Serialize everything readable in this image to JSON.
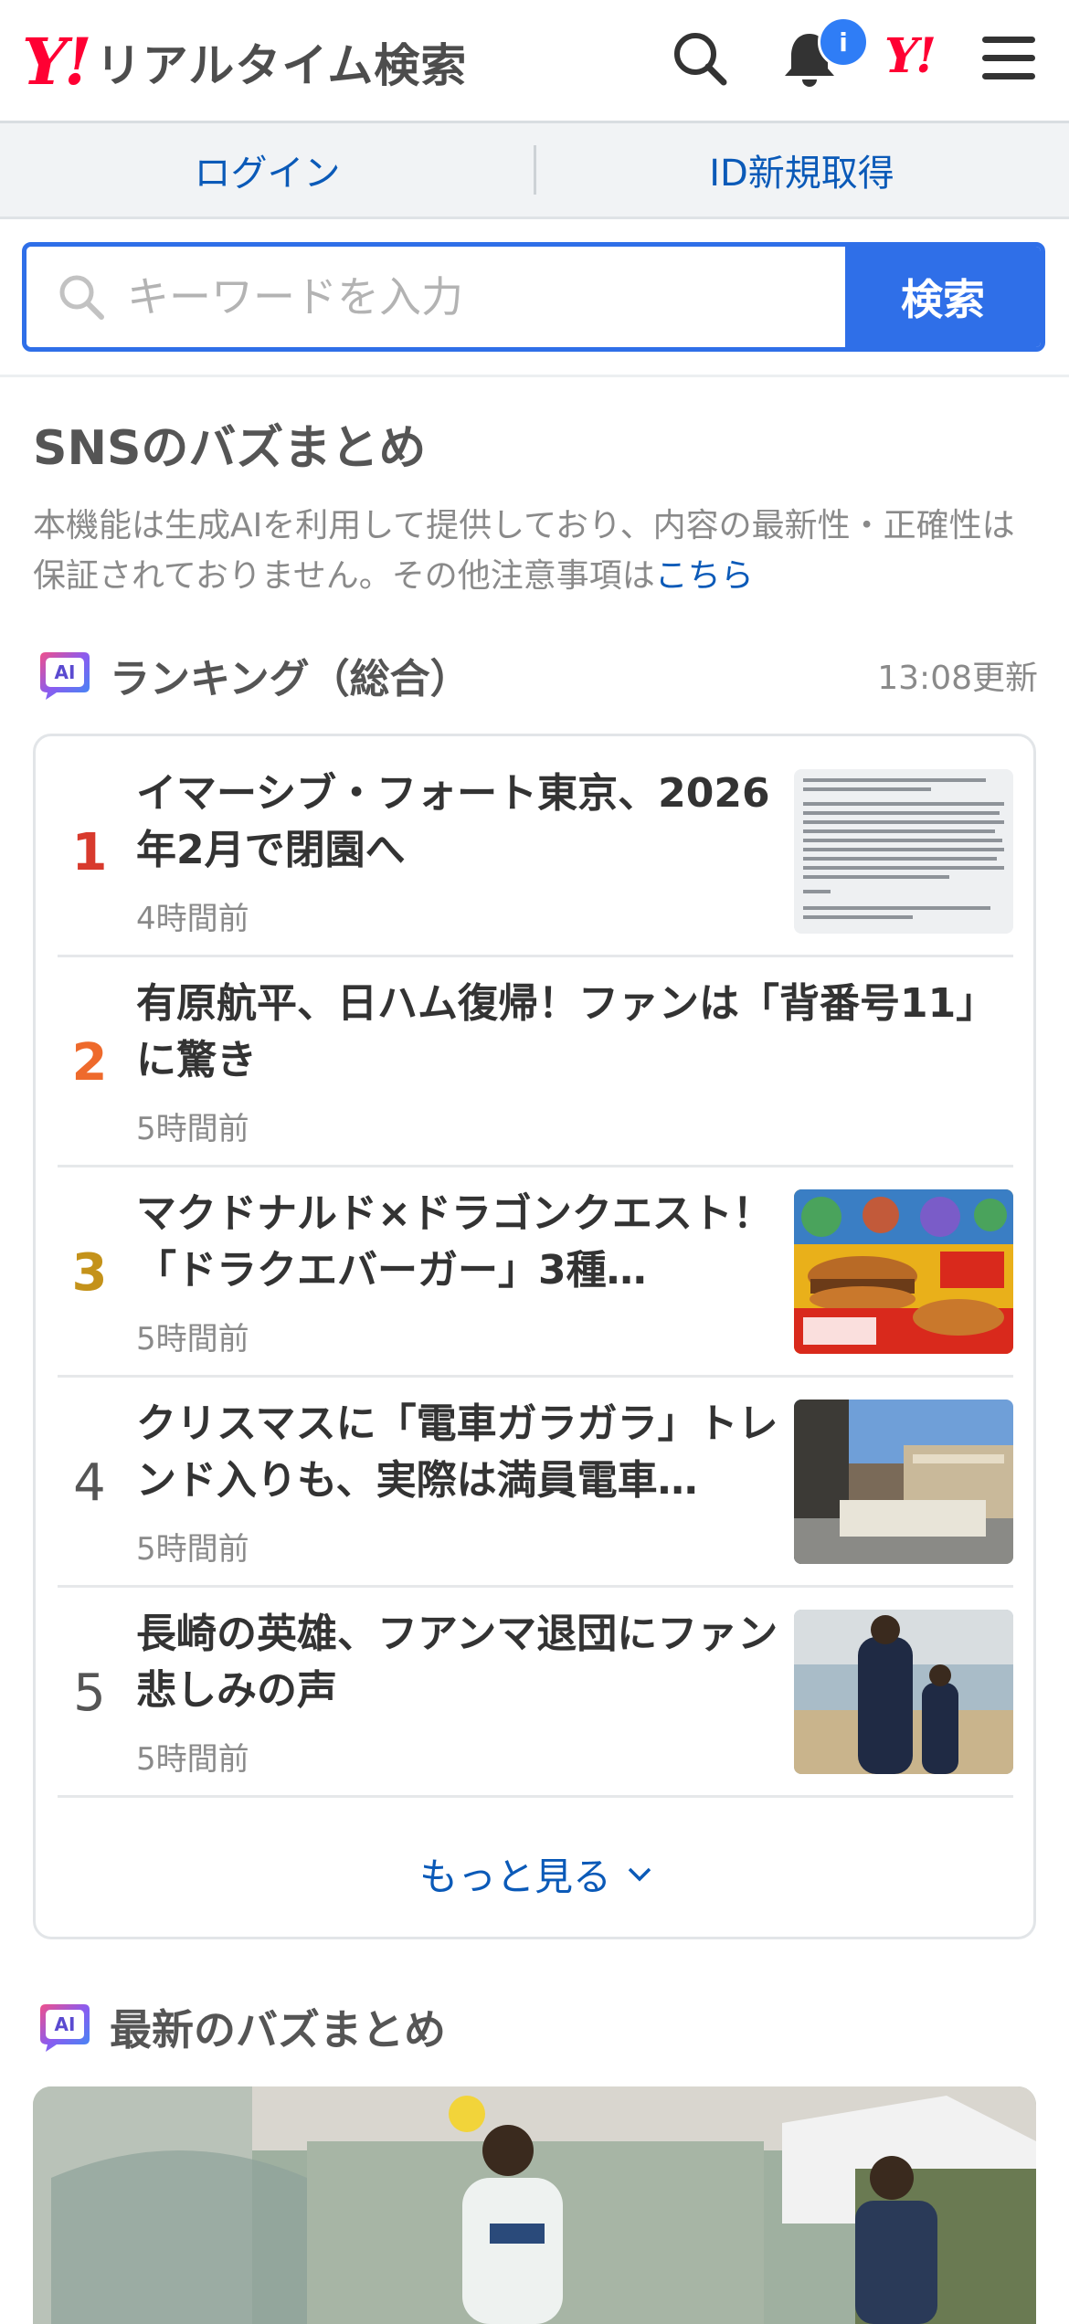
{
  "header": {
    "logo_mark": "Y!",
    "logo_text": "リアルタイム検索",
    "notification_badge": "i",
    "yahoo_mark": "Y!"
  },
  "account": {
    "login_label": "ログイン",
    "register_label": "ID新規取得"
  },
  "search": {
    "placeholder": "キーワードを入力",
    "button_label": "検索"
  },
  "buzz": {
    "title": "SNSのバズまとめ",
    "notice_text": "本機能は生成AIを利用して提供しており、内容の最新性・正確性は保証されておりません。その他注意事項は",
    "notice_link": "こちら"
  },
  "ranking": {
    "ai_label": "AI",
    "title": "ランキング（総合）",
    "updated": "13:08更新",
    "items": [
      {
        "rank": "1",
        "title": "イマーシブ・フォート東京、2026年2月で閉園へ",
        "time": "4時間前",
        "rank_color": "#d83a2d",
        "thumb": "document"
      },
      {
        "rank": "2",
        "title": "有原航平、日ハム復帰！ファンは「背番号11」に驚き",
        "time": "5時間前",
        "rank_color": "#ee6a2c",
        "thumb": "none"
      },
      {
        "rank": "3",
        "title": "マクドナルド×ドラゴンクエスト！「ドラクエバーガー」3種…",
        "time": "5時間前",
        "rank_color": "#c4921a",
        "thumb": "burger"
      },
      {
        "rank": "4",
        "title": "クリスマスに「電車ガラガラ」トレンド入りも、実際は満員電車…",
        "time": "5時間前",
        "rank_color": "#555555",
        "thumb": "city"
      },
      {
        "rank": "5",
        "title": "長崎の英雄、フアンマ退団にファン悲しみの声",
        "time": "5時間前",
        "rank_color": "#555555",
        "thumb": "soccer"
      }
    ],
    "more_label": "もっと見る"
  },
  "latest": {
    "ai_label": "AI",
    "title": "最新のバズまとめ"
  },
  "colors": {
    "brand_red": "#ff0033",
    "accent_blue": "#2f6fe8",
    "link_blue": "#0b5ab8"
  },
  "icons": {
    "search": "search-icon",
    "bell": "bell-icon",
    "menu": "hamburger-menu-icon",
    "chevron": "chevron-down-icon"
  }
}
